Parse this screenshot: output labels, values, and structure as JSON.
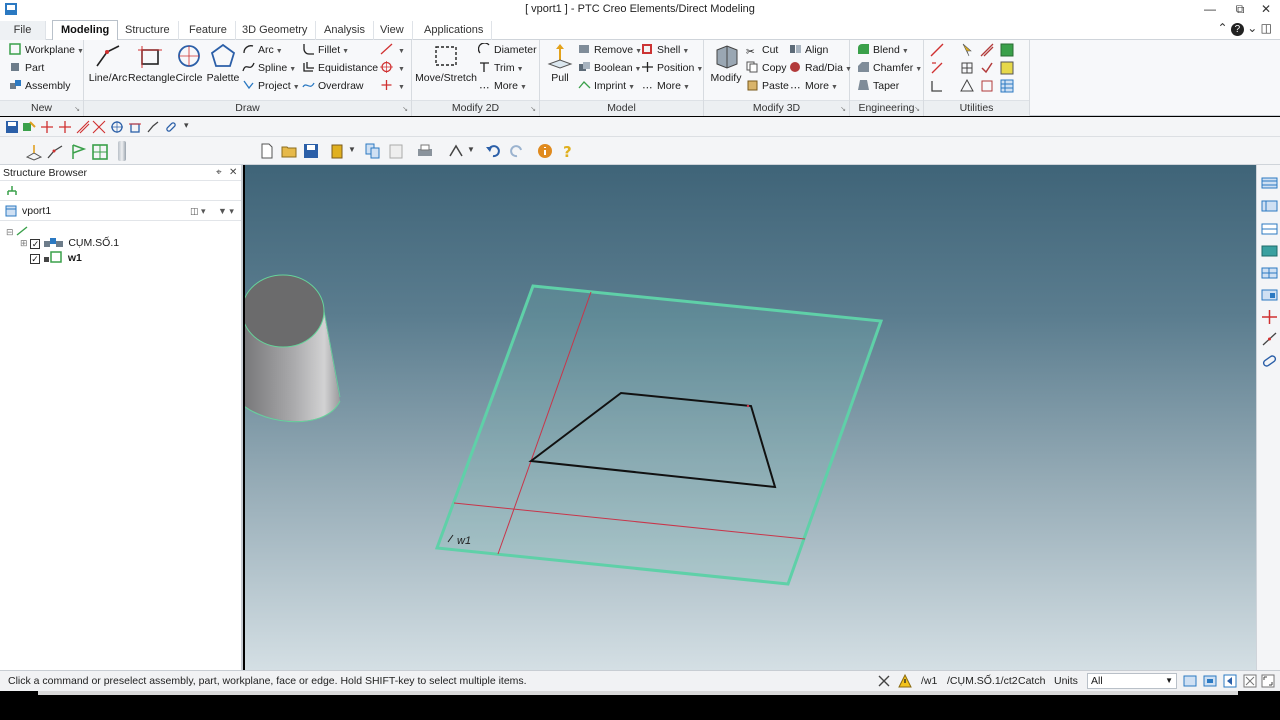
{
  "window": {
    "title": "[ vport1 ] - PTC Creo Elements/Direct Modeling"
  },
  "tabs": [
    "File",
    "Modeling",
    "Structure",
    "Feature",
    "3D Geometry",
    "Analysis",
    "View",
    "Applications"
  ],
  "ribbon": {
    "new": {
      "label": "New",
      "items": [
        "Workplane",
        "Part",
        "Assembly"
      ]
    },
    "draw": {
      "label": "Draw",
      "large": [
        "Line/Arc",
        "Rectangle",
        "Circle",
        "Palette"
      ],
      "col1": [
        "Arc",
        "Spline",
        "Project"
      ],
      "col2": [
        "Fillet",
        "Equidistance",
        "Overdraw"
      ]
    },
    "modify2d": {
      "label": "Modify 2D",
      "large": "Move/Stretch",
      "col": [
        "Diameter",
        "Trim",
        "More"
      ]
    },
    "model": {
      "label": "Model",
      "large": "Pull",
      "col1": [
        "Remove",
        "Boolean",
        "Imprint"
      ],
      "col2": [
        "Shell",
        "Position",
        "More"
      ]
    },
    "modify3d": {
      "label": "Modify 3D",
      "large": "Modify",
      "col1": [
        "Cut",
        "Copy",
        "Paste"
      ],
      "col2": [
        "Align",
        "Rad/Dia",
        "More"
      ]
    },
    "engineering": {
      "label": "Engineering",
      "col": [
        "Blend",
        "Chamfer",
        "Taper"
      ]
    },
    "utilities": {
      "label": "Utilities"
    }
  },
  "browser": {
    "title": "Structure Browser",
    "root": "vport1",
    "items": [
      {
        "label": "CỤM.SỐ.1",
        "type": "assembly",
        "checked": true
      },
      {
        "label": "w1",
        "type": "workplane",
        "checked": true
      }
    ]
  },
  "viewport": {
    "workplane_label": "w1"
  },
  "status": {
    "message": "Click a command or preselect assembly, part, workplane, face or edge. Hold SHIFT-key to select multiple items.",
    "workplane": "/w1",
    "path": "/CỤM.SỐ.1/ct2",
    "catch": "Catch",
    "units": "Units",
    "filter": "All"
  },
  "colors": {
    "accent": "#2b79c2",
    "workplane_edge": "#5fd0a8",
    "axis_red": "#c8354a"
  }
}
